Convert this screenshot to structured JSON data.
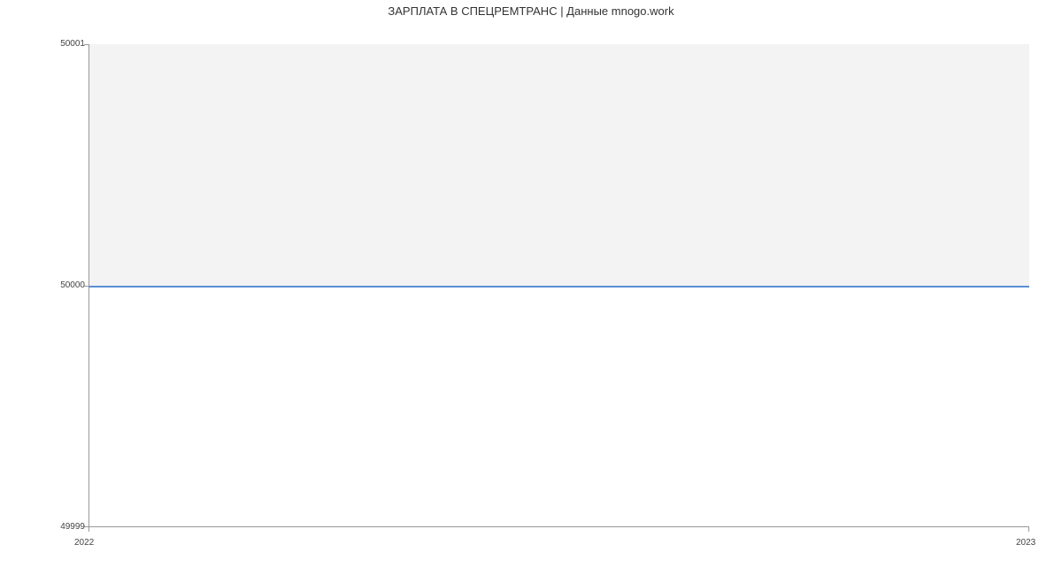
{
  "chart_data": {
    "type": "line",
    "title": "ЗАРПЛАТА В  СПЕЦРЕМТРАНС | Данные mnogo.work",
    "x": [
      2022,
      2023
    ],
    "values": [
      50000,
      50000
    ],
    "xlim": [
      2022,
      2023
    ],
    "ylim": [
      49999,
      50001
    ],
    "y_ticks": [
      49999,
      50000,
      50001
    ],
    "x_ticks": [
      2022,
      2023
    ],
    "xlabel": "",
    "ylabel": ""
  }
}
